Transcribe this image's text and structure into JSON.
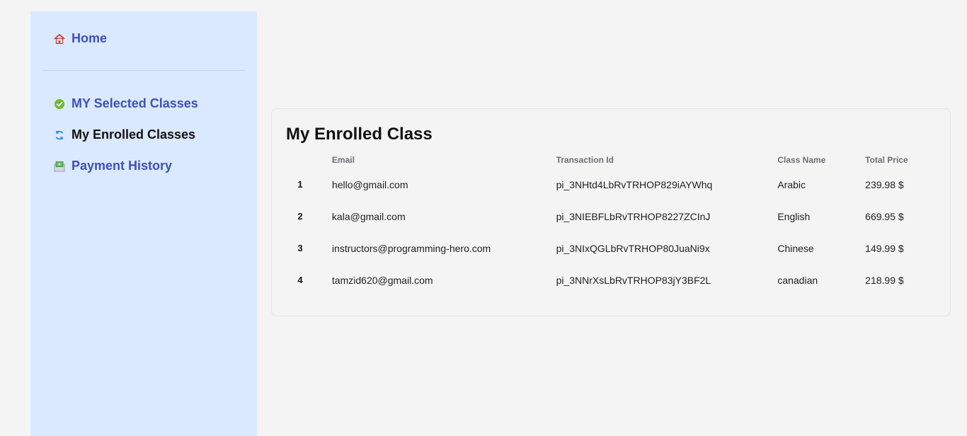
{
  "sidebar": {
    "top_items": [
      {
        "label": "Home",
        "icon": "home-icon"
      }
    ],
    "items": [
      {
        "label": "MY Selected Classes",
        "icon": "check-circle-icon"
      },
      {
        "label": "My Enrolled Classes",
        "icon": "refresh-icon",
        "active": true
      },
      {
        "label": "Payment History",
        "icon": "money-icon"
      }
    ]
  },
  "main": {
    "title": "My Enrolled Class",
    "table": {
      "headers": [
        "",
        "Email",
        "Transaction Id",
        "Class Name",
        "Total Price"
      ],
      "rows": [
        {
          "num": "1",
          "email": "hello@gmail.com",
          "transaction": "pi_3NHtd4LbRvTRHOP829iAYWhq",
          "class_name": "Arabic",
          "price": "239.98 $"
        },
        {
          "num": "2",
          "email": "kala@gmail.com",
          "transaction": "pi_3NIEBFLbRvTRHOP8227ZCInJ",
          "class_name": "English",
          "price": "669.95 $"
        },
        {
          "num": "3",
          "email": "instructors@programming-hero.com",
          "transaction": "pi_3NIxQGLbRvTRHOP80JuaNi9x",
          "class_name": "Chinese",
          "price": "149.99 $"
        },
        {
          "num": "4",
          "email": "tamzid620@gmail.com",
          "transaction": "pi_3NNrXsLbRvTRHOP83jY3BF2L",
          "class_name": "canadian",
          "price": "218.99 $"
        }
      ]
    }
  },
  "colors": {
    "sidebar_bg": "#dbe9fe",
    "nav_link": "#3f51b5",
    "active_link": "#111111",
    "page_bg": "#f4f4f4"
  }
}
